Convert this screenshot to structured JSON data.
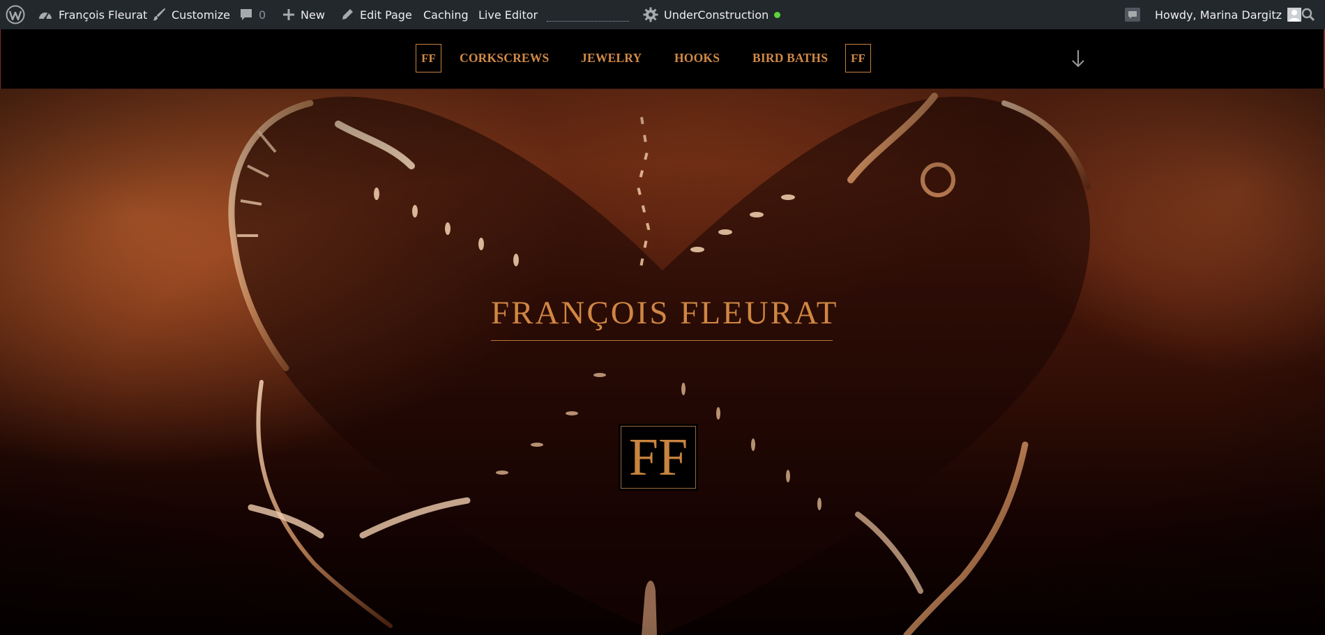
{
  "admin_bar": {
    "site_name": "François Fleurat",
    "customize": "Customize",
    "comments_count": "0",
    "new": "New",
    "edit_page": "Edit Page",
    "caching": "Caching",
    "live_editor": "Live Editor",
    "under_construction": "UnderConstruction",
    "under_construction_status_color": "#5fd33a",
    "greeting": "Howdy, Marina Dargitz",
    "icons": [
      "wordpress-logo-icon",
      "dashboard-icon",
      "brush-icon",
      "comment-icon",
      "plus-icon",
      "pencil-icon",
      "gear-icon",
      "notification-icon",
      "avatar-icon",
      "search-icon"
    ]
  },
  "nav": {
    "logo_left": "FF",
    "links": [
      "CORKSCREWS",
      "JEWELRY",
      "HOOKS",
      "BIRD BATHS"
    ],
    "logo_right": "FF",
    "scroll_icon": "arrow-down-icon",
    "accent_color": "#d28a46"
  },
  "hero": {
    "title": "FRANÇOIS FLEURAT",
    "logo": "FF"
  }
}
